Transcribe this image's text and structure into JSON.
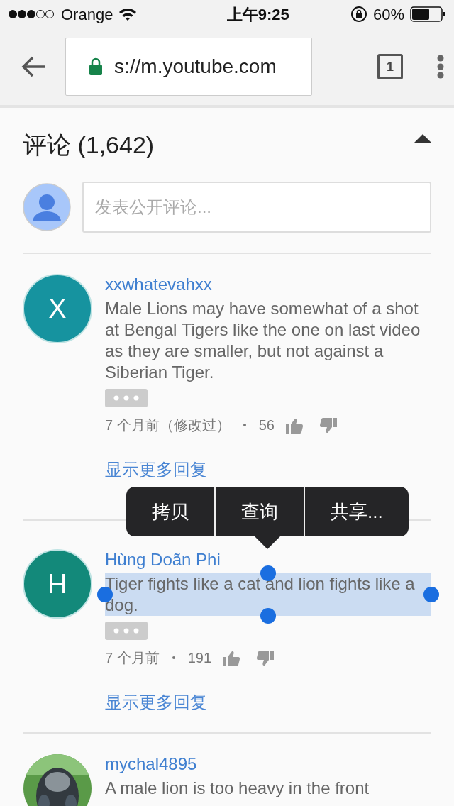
{
  "status_bar": {
    "carrier": "Orange",
    "time": "上午9:25",
    "battery": "60%"
  },
  "browser": {
    "url": "s://m.youtube.com",
    "tab_count": "1"
  },
  "comments_header": {
    "title": "评论 (1,642)",
    "expanded": true
  },
  "composer": {
    "placeholder": "发表公开评论..."
  },
  "comments": [
    {
      "kind": "letter",
      "initial": "X",
      "color": "#16939f",
      "author": "xxwhatevahxx",
      "text": "Male Lions may have somewhat of a shot at Bengal Tigers like the one on last video as they are smaller, but not against a Siberian Tiger.",
      "selected": false,
      "time": "7 个月前（修改过）",
      "likes": "56",
      "more_replies": "显示更多回复"
    },
    {
      "kind": "letter",
      "initial": "H",
      "color": "#13897a",
      "author": "Hùng Doãn Phi",
      "text": "Tiger fights like a cat and lion fights like a dog.",
      "selected": true,
      "time": "7 个月前",
      "likes": "191",
      "more_replies": "显示更多回复"
    },
    {
      "kind": "picture",
      "author": "mychal4895",
      "text": "A male lion is too heavy in the front",
      "selected": false
    }
  ],
  "context_menu": {
    "items": [
      "拷贝",
      "查询",
      "共享..."
    ]
  }
}
